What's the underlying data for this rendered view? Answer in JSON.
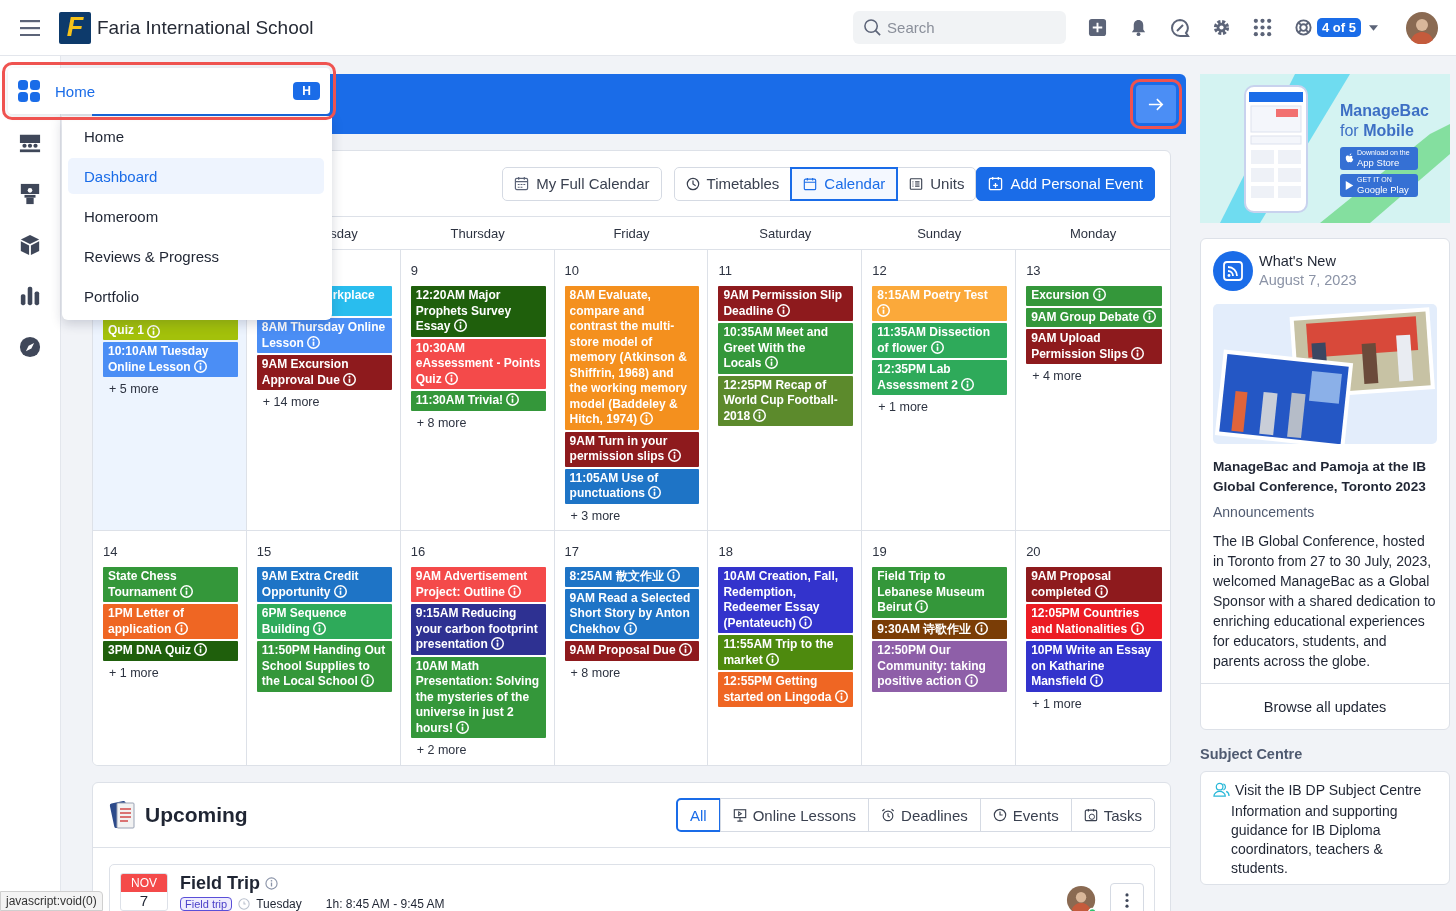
{
  "header": {
    "logo": "F",
    "school": "Faria International School",
    "search": {
      "placeholder": "Search"
    },
    "badge": "4 of 5"
  },
  "nav_flyout": {
    "label": "Home",
    "shortcut": "H",
    "items": [
      {
        "label": "Home",
        "selected": false
      },
      {
        "label": "Dashboard",
        "selected": true
      },
      {
        "label": "Homeroom",
        "selected": false
      },
      {
        "label": "Reviews & Progress",
        "selected": false
      },
      {
        "label": "Portfolio",
        "selected": false
      }
    ]
  },
  "calendar": {
    "full_calendar_button": "My Full Calendar",
    "views": [
      {
        "label": "Timetables",
        "selected": false
      },
      {
        "label": "Calendar",
        "selected": true
      },
      {
        "label": "Units",
        "selected": false
      }
    ],
    "add_button": "Add Personal Event",
    "headers": [
      {
        "label": "sday",
        "kind": "cut"
      },
      {
        "label": "Thursday",
        "kind": "full"
      },
      {
        "label": "Friday",
        "kind": "full"
      },
      {
        "label": "Saturday",
        "kind": "full"
      },
      {
        "label": "Sunday",
        "kind": "full"
      },
      {
        "label": "Monday",
        "kind": "full"
      }
    ],
    "weeks": [
      [
        {
          "today": true,
          "events": [
            {
              "text": "Quiz 1",
              "color": "#a3c10a",
              "kind": "cliptop"
            },
            {
              "text": "10:10AM Tuesday Online Lesson",
              "color": "#4b8ef5",
              "kind": "full"
            }
          ],
          "more": "+ 5 more"
        },
        {
          "today": false,
          "events": [
            {
              "text": "rkplace",
              "color": "#29bdee",
              "kind": "clipleft"
            },
            {
              "text": "8AM Thursday Online Lesson",
              "color": "#4b8ef5",
              "kind": "full"
            },
            {
              "text": "9AM Excursion Approval Due",
              "color": "#8e1a1d",
              "kind": "full"
            }
          ],
          "more": "+ 14 more"
        },
        {
          "day": "9",
          "today": false,
          "events": [
            {
              "text": "12:20AM Major Prophets Survey Essay",
              "color": "#1f5f0c",
              "kind": "full"
            },
            {
              "text": "10:30AM eAssessment - Points Quiz",
              "color": "#f44a4a",
              "kind": "full"
            },
            {
              "text": "11:30AM Trivia!",
              "color": "#34973a",
              "kind": "full"
            }
          ],
          "more": "+ 8 more"
        },
        {
          "day": "10",
          "today": false,
          "events": [
            {
              "text": "8AM Evaluate, compare and contrast the multi-store model of memory (Atkinson & Shiffrin, 1968) and the working memory model (Baddeley & Hitch, 1974)",
              "color": "#f4901e",
              "kind": "full"
            },
            {
              "text": "9AM Turn in your permission slips",
              "color": "#8e1a1d",
              "kind": "full"
            },
            {
              "text": "11:05AM Use of punctuations",
              "color": "#1e74c6",
              "kind": "full"
            }
          ],
          "more": "+ 3 more"
        },
        {
          "day": "11",
          "today": false,
          "events": [
            {
              "text": "9AM Permission Slip Deadline",
              "color": "#8e1a1d",
              "kind": "full"
            },
            {
              "text": "10:35AM Meet and Greet With the Locals",
              "color": "#34973a",
              "kind": "full"
            },
            {
              "text": "12:25PM Recap of World Cup Football-2018",
              "color": "#5c8a2c",
              "kind": "full"
            }
          ]
        },
        {
          "day": "12",
          "today": false,
          "events": [
            {
              "text": "8:15AM Poetry Test",
              "color": "#fba93a",
              "kind": "full"
            },
            {
              "text": "11:35AM Dissection of flower",
              "color": "#2eaa5a",
              "kind": "full"
            },
            {
              "text": "12:35PM Lab Assessment 2",
              "color": "#2eaa5a",
              "kind": "full"
            }
          ],
          "more": "+ 1 more"
        },
        {
          "day": "13",
          "today": false,
          "events": [
            {
              "text": "Excursion",
              "color": "#34973a",
              "kind": "full"
            },
            {
              "text": "9AM Group Debate",
              "color": "#34973a",
              "kind": "full"
            },
            {
              "text": "9AM Upload Permission Slips",
              "color": "#8e1a1d",
              "kind": "full"
            }
          ],
          "more": "+ 4 more"
        }
      ],
      [
        {
          "day": "14",
          "today": false,
          "events": [
            {
              "text": "State Chess Tournament",
              "color": "#34973a",
              "kind": "full"
            },
            {
              "text": "1PM Letter of application",
              "color": "#ef6623",
              "kind": "full"
            },
            {
              "text": "3PM DNA Quiz",
              "color": "#1f5f0c",
              "kind": "full"
            }
          ],
          "more": "+ 1 more"
        },
        {
          "day": "15",
          "today": false,
          "events": [
            {
              "text": "9AM Extra Credit Opportunity",
              "color": "#1e74c6",
              "kind": "full"
            },
            {
              "text": "6PM Sequence Building",
              "color": "#2eaa5a",
              "kind": "full"
            },
            {
              "text": "11:50PM Handing Out School Supplies to the Local School",
              "color": "#34973a",
              "kind": "full"
            }
          ]
        },
        {
          "day": "16",
          "today": false,
          "events": [
            {
              "text": "9AM Advertisement Project: Outline",
              "color": "#f44a4a",
              "kind": "full"
            },
            {
              "text": "9:15AM Reducing your carbon footprint presentation",
              "color": "#2e3192",
              "kind": "full"
            },
            {
              "text": "10AM Math Presentation: Solving the mysteries of the universe in just 2 hours!",
              "color": "#34973a",
              "kind": "full"
            }
          ],
          "more": "+ 2 more"
        },
        {
          "day": "17",
          "today": false,
          "events": [
            {
              "text": "8:25AM 散文作业",
              "color": "#1e74c6",
              "kind": "full"
            },
            {
              "text": "9AM Read a Selected Short Story by Anton Chekhov",
              "color": "#1e74c6",
              "kind": "full"
            },
            {
              "text": "9AM Proposal Due",
              "color": "#8e1a1d",
              "kind": "full"
            }
          ],
          "more": "+ 8 more"
        },
        {
          "day": "18",
          "today": false,
          "events": [
            {
              "text": "10AM Creation, Fall, Redemption, Redeemer Essay (Pentateuch)",
              "color": "#3333cc",
              "kind": "full"
            },
            {
              "text": "11:55AM Trip to the market",
              "color": "#4e8a0e",
              "kind": "full"
            },
            {
              "text": "12:55PM Getting started on Lingoda",
              "color": "#ef6623",
              "kind": "full"
            }
          ]
        },
        {
          "day": "19",
          "today": false,
          "events": [
            {
              "text": "Field Trip to Lebanese Museum Beirut",
              "color": "#34973a",
              "kind": "full"
            },
            {
              "text": "9:30AM 诗歌作业",
              "color": "#7a3d06",
              "kind": "full"
            },
            {
              "text": "12:50PM Our Community: taking positive action",
              "color": "#8e5fa8",
              "kind": "full"
            }
          ]
        },
        {
          "day": "20",
          "today": false,
          "events": [
            {
              "text": "9AM Proposal completed",
              "color": "#8e1a1d",
              "kind": "full"
            },
            {
              "text": "12:05PM Countries and Nationalities",
              "color": "#ec1c24",
              "kind": "full"
            },
            {
              "text": "10PM Write an Essay on Katharine Mansfield",
              "color": "#3333cc",
              "kind": "full"
            }
          ],
          "more": "+ 1 more"
        }
      ]
    ]
  },
  "upcoming": {
    "title": "Upcoming",
    "filters": [
      {
        "label": "All",
        "selected": true
      },
      {
        "label": "Online Lessons",
        "selected": false
      },
      {
        "label": "Deadlines",
        "selected": false
      },
      {
        "label": "Events",
        "selected": false
      },
      {
        "label": "Tasks",
        "selected": false
      }
    ],
    "items": [
      {
        "month": "NOV",
        "day": "7",
        "title": "Field Trip",
        "tag": "Field trip",
        "weekday": "Tuesday",
        "time": "1h: 8:45 AM - 9:45 AM"
      }
    ]
  },
  "promo": {
    "brand": "ManageBac",
    "subtitle": "for **Mobile**",
    "stores": [
      {
        "small": "Download on the",
        "name": "App Store"
      },
      {
        "small": "GET IT ON",
        "name": "Google Play"
      }
    ]
  },
  "whats_new": {
    "title": "What's New",
    "date": "August 7, 2023",
    "headline": "ManageBac and Pamoja at the IB Global Conference, Toronto 2023",
    "category": "Announcements",
    "body": "The IB Global Conference, hosted in Toronto from 27 to 30 July, 2023, welcomed ManageBac as a Global Sponsor with a shared dedication to enriching educational experiences for educators, students, and parents across the globe.",
    "link": "Browse all updates"
  },
  "subject_centre": {
    "heading": "Subject Centre",
    "link": "Visit the IB DP Subject Centre",
    "description": "Information and supporting guidance for IB Diploma coordinators, teachers & students."
  },
  "status_bar": "javascript:void(0)"
}
